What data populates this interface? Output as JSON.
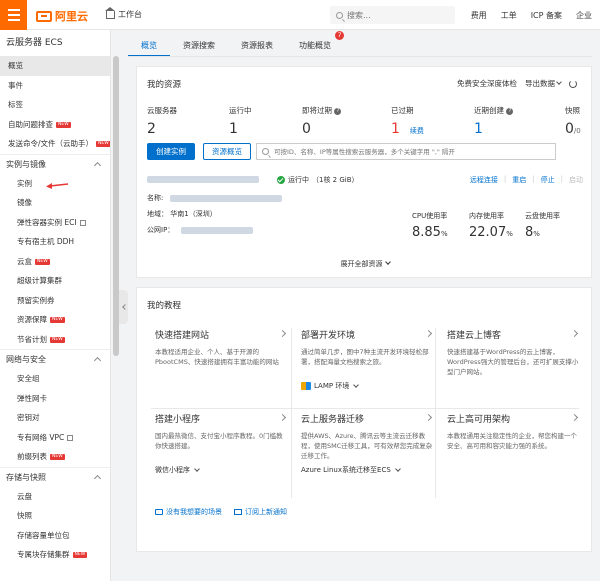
{
  "header": {
    "logo_text": "阿里云",
    "workbench": "工作台",
    "search_placeholder": "搜索...",
    "links": [
      "费用",
      "工单",
      "ICP 备案",
      "企业"
    ]
  },
  "sidebar": {
    "title": "云服务器 ECS",
    "top_items": [
      {
        "label": "概览",
        "active": true
      },
      {
        "label": "事件"
      },
      {
        "label": "标签"
      },
      {
        "label": "自助问题排查",
        "badge": "NEW"
      },
      {
        "label": "发送命令/文件（云助手）",
        "badge": "NEW"
      }
    ],
    "groups": [
      {
        "label": "实例与镜像",
        "items": [
          {
            "label": "实例"
          },
          {
            "label": "镜像"
          },
          {
            "label": "弹性容器实例 ECI",
            "ext": true
          },
          {
            "label": "专有宿主机 DDH"
          },
          {
            "label": "云盒",
            "badge": "NEW"
          },
          {
            "label": "超级计算集群"
          },
          {
            "label": "预留实例券"
          },
          {
            "label": "资源保障",
            "badge": "NEW"
          },
          {
            "label": "节省计划",
            "badge": "NEW"
          }
        ]
      },
      {
        "label": "网络与安全",
        "items": [
          {
            "label": "安全组"
          },
          {
            "label": "弹性网卡"
          },
          {
            "label": "密钥对"
          },
          {
            "label": "专有网络 VPC",
            "ext": true
          },
          {
            "label": "前缀列表",
            "badge": "NEW"
          }
        ]
      },
      {
        "label": "存储与快照",
        "items": [
          {
            "label": "云盘"
          },
          {
            "label": "快照"
          },
          {
            "label": "存储容量单位包"
          },
          {
            "label": "专属块存储集群",
            "badge": "NEW"
          }
        ]
      }
    ]
  },
  "tabs": [
    {
      "label": "概览",
      "active": true
    },
    {
      "label": "资源搜索"
    },
    {
      "label": "资源报表"
    },
    {
      "label": "功能概览",
      "badge": "7"
    }
  ],
  "resources": {
    "title": "我的资源",
    "actions": [
      "免费安全深度体检",
      "导出数据"
    ],
    "stats": [
      {
        "label": "云服务器",
        "value": "2"
      },
      {
        "label": "运行中",
        "value": "1"
      },
      {
        "label": "即将过期",
        "value": "0",
        "help": true
      },
      {
        "label": "已过期",
        "value": "1",
        "red": true,
        "extra": "续费"
      },
      {
        "label": "近期创建",
        "value": "1",
        "help": true,
        "blue": true
      },
      {
        "label": "快照",
        "value": "0",
        "suffix": "/0"
      }
    ],
    "create_btn": "创建实例",
    "overview_btn": "资源概览",
    "search_placeholder": "可按ID、名称、IP等属性搜索云服务器，多个关键字用 \",\" 隔开",
    "instance": {
      "status": "运行中",
      "spec": "（1核 2 GiB）",
      "ops": [
        "远程连接",
        "重启",
        "停止",
        "启动"
      ],
      "name_label": "名称:",
      "region_label": "地域：",
      "region_value": "华南1（深圳）",
      "ip_label": "公网IP：",
      "metrics": [
        {
          "label": "CPU使用率",
          "value": "8.85",
          "unit": "%"
        },
        {
          "label": "内存使用率",
          "value": "22.07",
          "unit": "%"
        },
        {
          "label": "云盘使用率",
          "value": "8",
          "unit": "%"
        }
      ]
    },
    "expand_all": "展开全部资源"
  },
  "tutorials": {
    "title": "我的教程",
    "items": [
      {
        "title": "快速搭建网站",
        "desc": "本教程适用企业、个人、基于开源的PbootCMS、快速搭建拥有丰富功能的网站",
        "foot": ""
      },
      {
        "title": "部署开发环境",
        "desc": "通过简单几步，图中7种主流开发环境轻松部署，搭配海量文档搜索之旅。",
        "foot": "LAMP 环境"
      },
      {
        "title": "搭建云上博客",
        "desc": "快速搭建基于WordPress的云上博客，WordPress强大的管理后台，还可扩展支撑小型门户网站。",
        "foot": ""
      },
      {
        "title": "搭建小程序",
        "desc": "国内最热微信、支付宝小程序教程。0门槛教你快速搭建。",
        "foot": "微信小程序"
      },
      {
        "title": "云上服务器迁移",
        "desc": "提供AWS、Azure、腾讯云等主流云迁移教程，使用SMC迁移工具，可有效帮您完成复杂迁移工作。",
        "foot": "Azure Linux系统迁移至ECS"
      },
      {
        "title": "云上高可用架构",
        "desc": "本教程通用关注稳定性的企业，帮您构建一个安全、高可用和容灾能力强的系统。",
        "foot": ""
      }
    ],
    "links": [
      "没有我想要的场景",
      "订阅上新通知"
    ]
  }
}
